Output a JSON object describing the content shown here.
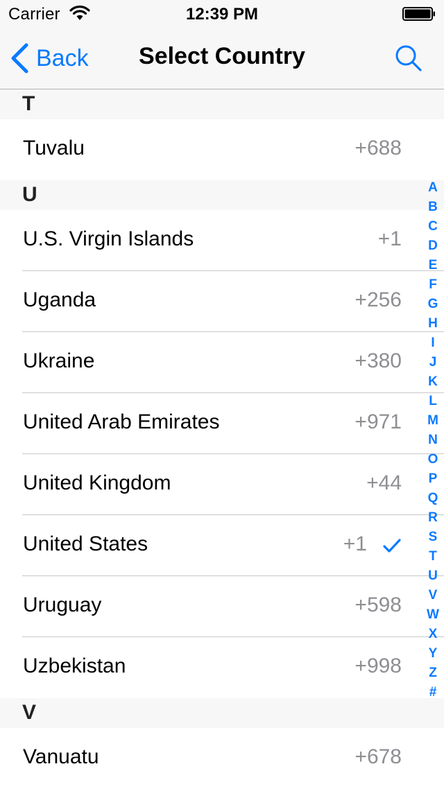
{
  "status_bar": {
    "carrier": "Carrier",
    "time": "12:39 PM"
  },
  "nav": {
    "back_label": "Back",
    "title": "Select Country"
  },
  "colors": {
    "accent": "#0a7aff",
    "code_gray": "#8e8e93",
    "header_bg": "#f7f7f7"
  },
  "sections": [
    {
      "letter": "T",
      "countries": [
        {
          "name": "Tuvalu",
          "code": "+688",
          "selected": false
        }
      ]
    },
    {
      "letter": "U",
      "countries": [
        {
          "name": "U.S. Virgin Islands",
          "code": "+1",
          "selected": false
        },
        {
          "name": "Uganda",
          "code": "+256",
          "selected": false
        },
        {
          "name": "Ukraine",
          "code": "+380",
          "selected": false
        },
        {
          "name": "United Arab Emirates",
          "code": "+971",
          "selected": false
        },
        {
          "name": "United Kingdom",
          "code": "+44",
          "selected": false
        },
        {
          "name": "United States",
          "code": "+1",
          "selected": true
        },
        {
          "name": "Uruguay",
          "code": "+598",
          "selected": false
        },
        {
          "name": "Uzbekistan",
          "code": "+998",
          "selected": false
        }
      ]
    },
    {
      "letter": "V",
      "countries": [
        {
          "name": "Vanuatu",
          "code": "+678",
          "selected": false
        }
      ]
    }
  ],
  "index_letters": [
    "A",
    "B",
    "C",
    "D",
    "E",
    "F",
    "G",
    "H",
    "I",
    "J",
    "K",
    "L",
    "M",
    "N",
    "O",
    "P",
    "Q",
    "R",
    "S",
    "T",
    "U",
    "V",
    "W",
    "X",
    "Y",
    "Z",
    "#"
  ]
}
